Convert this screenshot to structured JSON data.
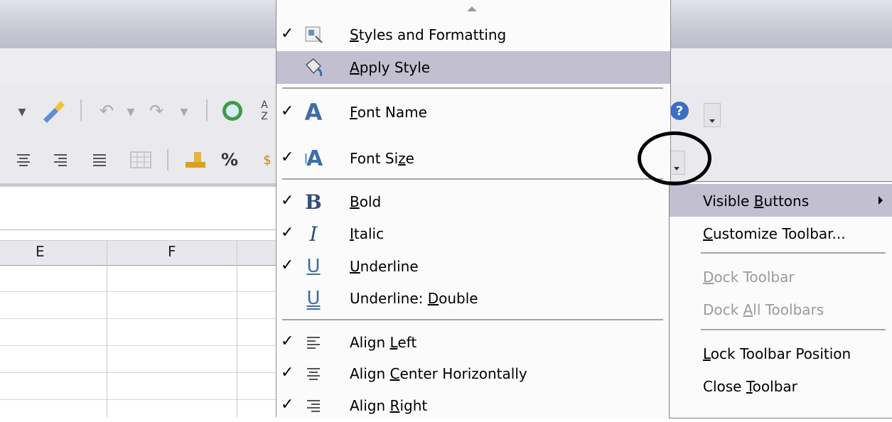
{
  "spreadsheet": {
    "column_headers": [
      "E",
      "F"
    ]
  },
  "toolbar": {
    "percent_label": "%"
  },
  "main_menu": {
    "items": [
      {
        "label_pre": "",
        "label_u": "S",
        "label_post": "tyles and Formatting",
        "checked": true,
        "icon": "styles-formatting-icon"
      },
      {
        "label_pre": "",
        "label_u": "A",
        "label_post": "pply Style",
        "checked": false,
        "icon": "apply-style-paint-icon"
      },
      {
        "label_pre": "",
        "label_u": "F",
        "label_post": "ont Name",
        "checked": true,
        "icon": "font-name-icon"
      },
      {
        "label_pre": "Font Si",
        "label_u": "z",
        "label_post": "e",
        "checked": true,
        "icon": "font-size-icon"
      },
      {
        "label_pre": "",
        "label_u": "B",
        "label_post": "old",
        "checked": true,
        "icon": "bold-icon"
      },
      {
        "label_pre": "",
        "label_u": "I",
        "label_post": "talic",
        "checked": true,
        "icon": "italic-icon"
      },
      {
        "label_pre": "",
        "label_u": "U",
        "label_post": "nderline",
        "checked": true,
        "icon": "underline-icon"
      },
      {
        "label_pre": "Underline: ",
        "label_u": "D",
        "label_post": "ouble",
        "checked": false,
        "icon": "underline-double-icon"
      },
      {
        "label_pre": "Align ",
        "label_u": "L",
        "label_post": "eft",
        "checked": true,
        "icon": "align-left-icon"
      },
      {
        "label_pre": "Align ",
        "label_u": "C",
        "label_post": "enter Horizontally",
        "checked": true,
        "icon": "align-center-icon"
      },
      {
        "label_pre": "Align ",
        "label_u": "R",
        "label_post": "ight",
        "checked": true,
        "icon": "align-right-icon"
      }
    ],
    "check_glyph": "✓",
    "icon_glyphs": {
      "bold": "B",
      "italic": "I",
      "underline": "U",
      "font": "A"
    }
  },
  "context_menu": {
    "items": [
      {
        "label_pre": "Visible ",
        "label_u": "B",
        "label_post": "uttons",
        "highlighted": true,
        "disabled": false,
        "submenu": true
      },
      {
        "label_pre": "",
        "label_u": "C",
        "label_post": "ustomize Toolbar...",
        "highlighted": false,
        "disabled": false,
        "submenu": false
      },
      {
        "label_pre": "",
        "label_u": "D",
        "label_post": "ock Toolbar",
        "highlighted": false,
        "disabled": true,
        "submenu": false
      },
      {
        "label_pre": "Dock ",
        "label_u": "A",
        "label_post": "ll Toolbars",
        "highlighted": false,
        "disabled": true,
        "submenu": false
      },
      {
        "label_pre": "",
        "label_u": "L",
        "label_post": "ock Toolbar Position",
        "highlighted": false,
        "disabled": false,
        "submenu": false
      },
      {
        "label_pre": "Close ",
        "label_u": "T",
        "label_post": "oolbar",
        "highlighted": false,
        "disabled": false,
        "submenu": false
      }
    ]
  },
  "colors": {
    "highlight": "#c1bfd0",
    "disabled_text": "#9a9a9a",
    "icon_blue": "#3d6ea8"
  }
}
